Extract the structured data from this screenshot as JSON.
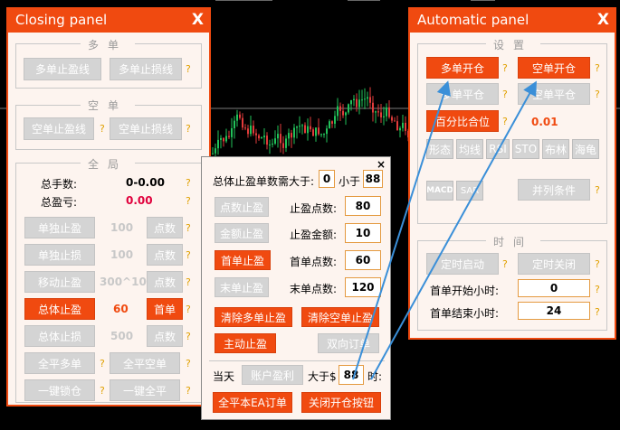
{
  "top_strip": [
    "⎯⎯⎯⎯⎯⎯⎯⎯⎯⎯⎯⎯⎯⎯",
    "⎯⎯⎯⎯⎯⎯⎯⎯",
    "⎯⎯⎯⎯⎯⎯"
  ],
  "closing_panel": {
    "title": "Closing panel",
    "close": "X",
    "long": {
      "title": "多单",
      "tp_button": "多单止盈线",
      "sl_button": "多单止损线"
    },
    "short": {
      "title": "空单",
      "tp_button": "空单止盈线",
      "sl_button": "空单止损线"
    },
    "global": {
      "title": "全局",
      "total_lots_label": "总手数:",
      "total_lots_value": "0-0.00",
      "total_pl_label": "总盈亏:",
      "total_pl_value": "0.00",
      "rows": [
        {
          "button": "单独止盈",
          "value": "100",
          "unit": "点数",
          "active": false
        },
        {
          "button": "单独止损",
          "value": "100",
          "unit": "点数",
          "active": false
        },
        {
          "button": "移动止盈",
          "value": "300^100",
          "unit": "点数",
          "active": false
        },
        {
          "button": "总体止盈",
          "value": "60",
          "unit": "首单",
          "active": true
        },
        {
          "button": "总体止损",
          "value": "500",
          "unit": "点数",
          "active": false
        }
      ],
      "close_long": "全平多单",
      "close_short": "全平空单",
      "lock": "一键锁仓",
      "close_all": "一键全平"
    },
    "help": "?"
  },
  "popup": {
    "close": "×",
    "total_tp_label": "总体止盈单数需大于:",
    "total_tp_min": "0",
    "less_than": "小于",
    "total_tp_max": "88",
    "point_tp_button": "点数止盈",
    "point_tp_label": "止盈点数:",
    "point_tp_value": "80",
    "amount_tp_button": "金额止盈",
    "amount_tp_label": "止盈金额:",
    "amount_tp_value": "10",
    "first_tp_button": "首单止盈",
    "first_points_label": "首单点数:",
    "first_points_value": "60",
    "last_tp_button": "末单止盈",
    "last_points_label": "末单点数:",
    "last_points_value": "120",
    "clear_long_tp": "清除多单止盈",
    "clear_short_tp": "清除空单止盈",
    "manual_tp": "主动止盈",
    "bidirectional": "双向订单",
    "today_label": "当天",
    "account_pl": "账户盈利",
    "greater_than": "大于$",
    "today_value": "88",
    "time_suffix": "时:",
    "close_all_ea": "全平本EA订单",
    "close_open_button": "关闭开仓按钮"
  },
  "auto_panel": {
    "title": "Automatic panel",
    "close": "X",
    "settings_title": "设置",
    "long_open": "多单开仓",
    "short_open": "空单开仓",
    "long_close": "多单平仓",
    "short_close": "空单平仓",
    "percent_close": "百分比合位",
    "percent_value": "0.01",
    "indicators": [
      "形态",
      "均线",
      "RSI",
      "STO",
      "布林",
      "海龟"
    ],
    "macd": "MACD",
    "sar": "SAR",
    "combined": "并列条件",
    "time_title": "时间",
    "timer_start": "定时启动",
    "timer_stop": "定时关闭",
    "first_start_label": "首单开始小时:",
    "first_start_value": "0",
    "first_end_label": "首单结束小时:",
    "first_end_value": "24",
    "help": "?"
  },
  "colors": {
    "accent": "#f04a10",
    "panel_bg": "#fdf4ef",
    "disabled": "#d4d4d4",
    "help": "#e0a000",
    "loss": "#e0003c",
    "arrow": "#3a8fd8"
  }
}
